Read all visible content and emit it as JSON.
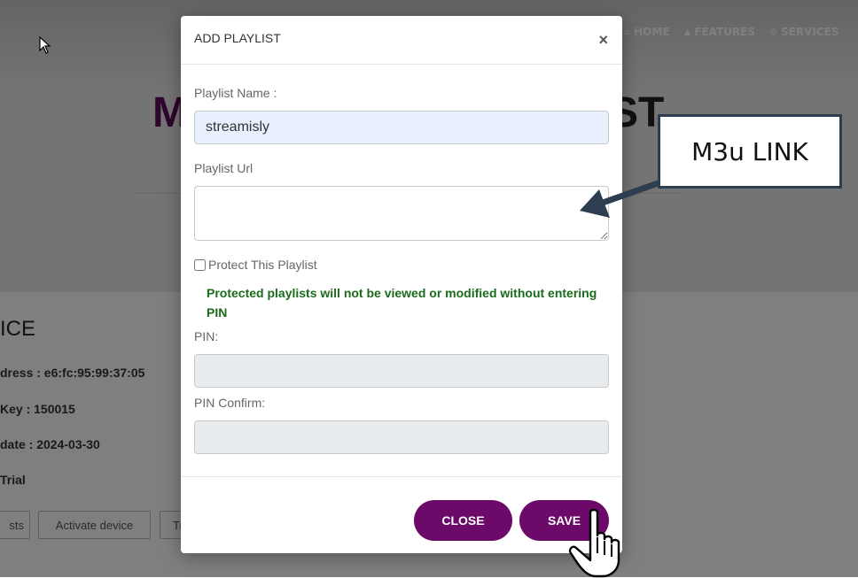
{
  "nav": {
    "items": [
      {
        "icon": "home-icon",
        "glyph": "⌂",
        "label": "HOME"
      },
      {
        "icon": "user-icon",
        "glyph": "▲",
        "label": "FEATURES"
      },
      {
        "icon": "gear-icon",
        "glyph": "⚙",
        "label": "SERVICES"
      }
    ]
  },
  "background": {
    "title_left": "M",
    "title_right": "ST",
    "device_heading": "ICE",
    "lines": [
      "dress : e6:fc:95:99:37:05",
      "Key : 150015",
      "date : 2024-03-30",
      " Trial"
    ],
    "buttons": [
      "sts",
      "Activate device",
      "Tr"
    ]
  },
  "modal": {
    "title": "ADD PLAYLIST",
    "close_x": "×",
    "playlist_name_label": "Playlist Name :",
    "playlist_name_value": "streamisly",
    "playlist_url_label": "Playlist Url",
    "playlist_url_value": "",
    "protect_label": "Protect This Playlist",
    "protect_checked": false,
    "protect_note": "Protected playlists will not be viewed or modified without entering PIN",
    "pin_label": "PIN:",
    "pin_confirm_label": "PIN Confirm:",
    "close_button": "CLOSE",
    "save_button": "SAVE"
  },
  "callout": {
    "text": "M3u LINK"
  },
  "colors": {
    "brand": "#6c0a69",
    "note_green": "#1a6b1a",
    "callout_border": "#2d3e50",
    "autofill_bg": "#e8f0fe",
    "disabled_bg": "#e9ecef"
  }
}
